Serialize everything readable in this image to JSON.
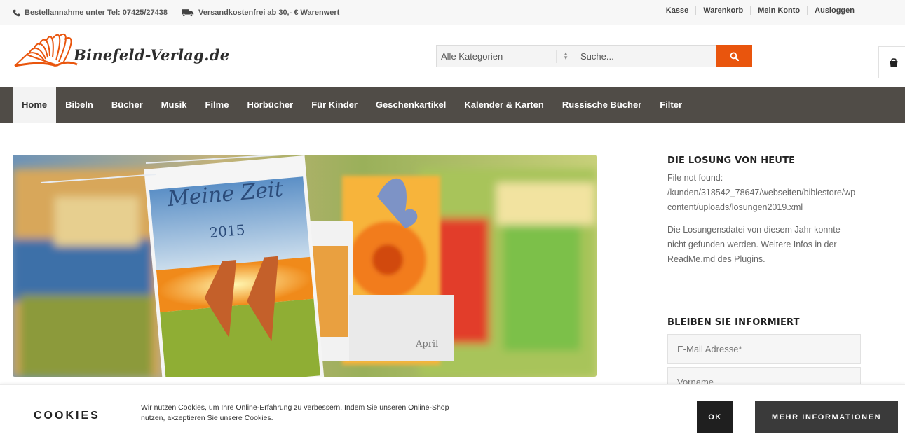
{
  "topbar": {
    "phone_text": "Bestellannahme unter Tel: 07425/27438",
    "shipping_text": "Versandkostenfrei ab 30,- € Warenwert",
    "links": [
      "Kasse",
      "Warenkorb",
      "Mein Konto",
      "Ausloggen"
    ]
  },
  "header": {
    "logo_text": "Binefeld-Verlag.de",
    "category_select": "Alle Kategorien",
    "search_placeholder": "Suche..."
  },
  "nav": {
    "items": [
      "Home",
      "Bibeln",
      "Bücher",
      "Musik",
      "Filme",
      "Hörbücher",
      "Für Kinder",
      "Geschenkartikel",
      "Kalender & Karten",
      "Russische Bücher",
      "Filter"
    ],
    "active": "Home"
  },
  "hero": {
    "calendar_title": "Meine Zeit",
    "calendar_year": "2015",
    "month_label": "April"
  },
  "sidebar": {
    "losung_title": "DIE LOSUNG VON HEUTE",
    "losung_error": "File not found:\n/kunden/318542_78647/webseiten/biblestore/wp-\ncontent/uploads/losungen2019.xml",
    "losung_info": "Die Losungensdatei von diesem Jahr konnte nicht gefunden werden. Weitere Infos in der ReadMe.md des Plugins.",
    "newsletter_title": "BLEIBEN SIE INFORMIERT",
    "email_placeholder": "E-Mail Adresse*",
    "firstname_placeholder": "Vorname"
  },
  "cookie": {
    "title": "COOKIES",
    "text": "Wir nutzen Cookies, um Ihre Online-Erfahrung zu verbessern. Indem Sie unseren Online-Shop nutzen, akzeptieren Sie unsere Cookies.",
    "ok_label": "OK",
    "more_label": "MEHR INFORMATIONEN"
  },
  "colors": {
    "accent": "#e9550d",
    "nav_bg": "#504c47",
    "cookie_btn": "#1f1f1f"
  }
}
